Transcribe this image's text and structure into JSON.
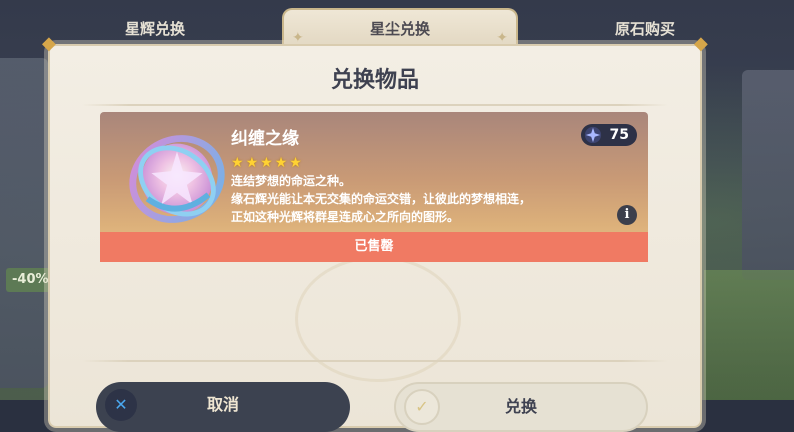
{
  "tabs": [
    {
      "label": "星辉兑换"
    },
    {
      "label": "星尘兑换"
    },
    {
      "label": "原石购买"
    }
  ],
  "background": {
    "discount_label": "-40%"
  },
  "dialog": {
    "title": "兑换物品",
    "item": {
      "name": "纠缠之缘",
      "stars": 5,
      "description": [
        "连结梦想的命运之种。",
        "缘石辉光能让本无交集的命运交错，让彼此的梦想相连，",
        "正如这种光辉将群星连成心之所向的图形。"
      ],
      "cost": "75",
      "status": "已售罄"
    },
    "buttons": {
      "cancel_label": "取消",
      "confirm_label": "兑换"
    }
  },
  "colors": {
    "card_gradient_top": "#a9867b",
    "card_gradient_bottom": "#e9c48a",
    "sold_bar": "#f07a63",
    "star": "#ffd233"
  },
  "icons": {
    "cost": "starglitter-icon",
    "info": "info-icon",
    "cancel": "close-icon",
    "confirm": "check-icon"
  }
}
